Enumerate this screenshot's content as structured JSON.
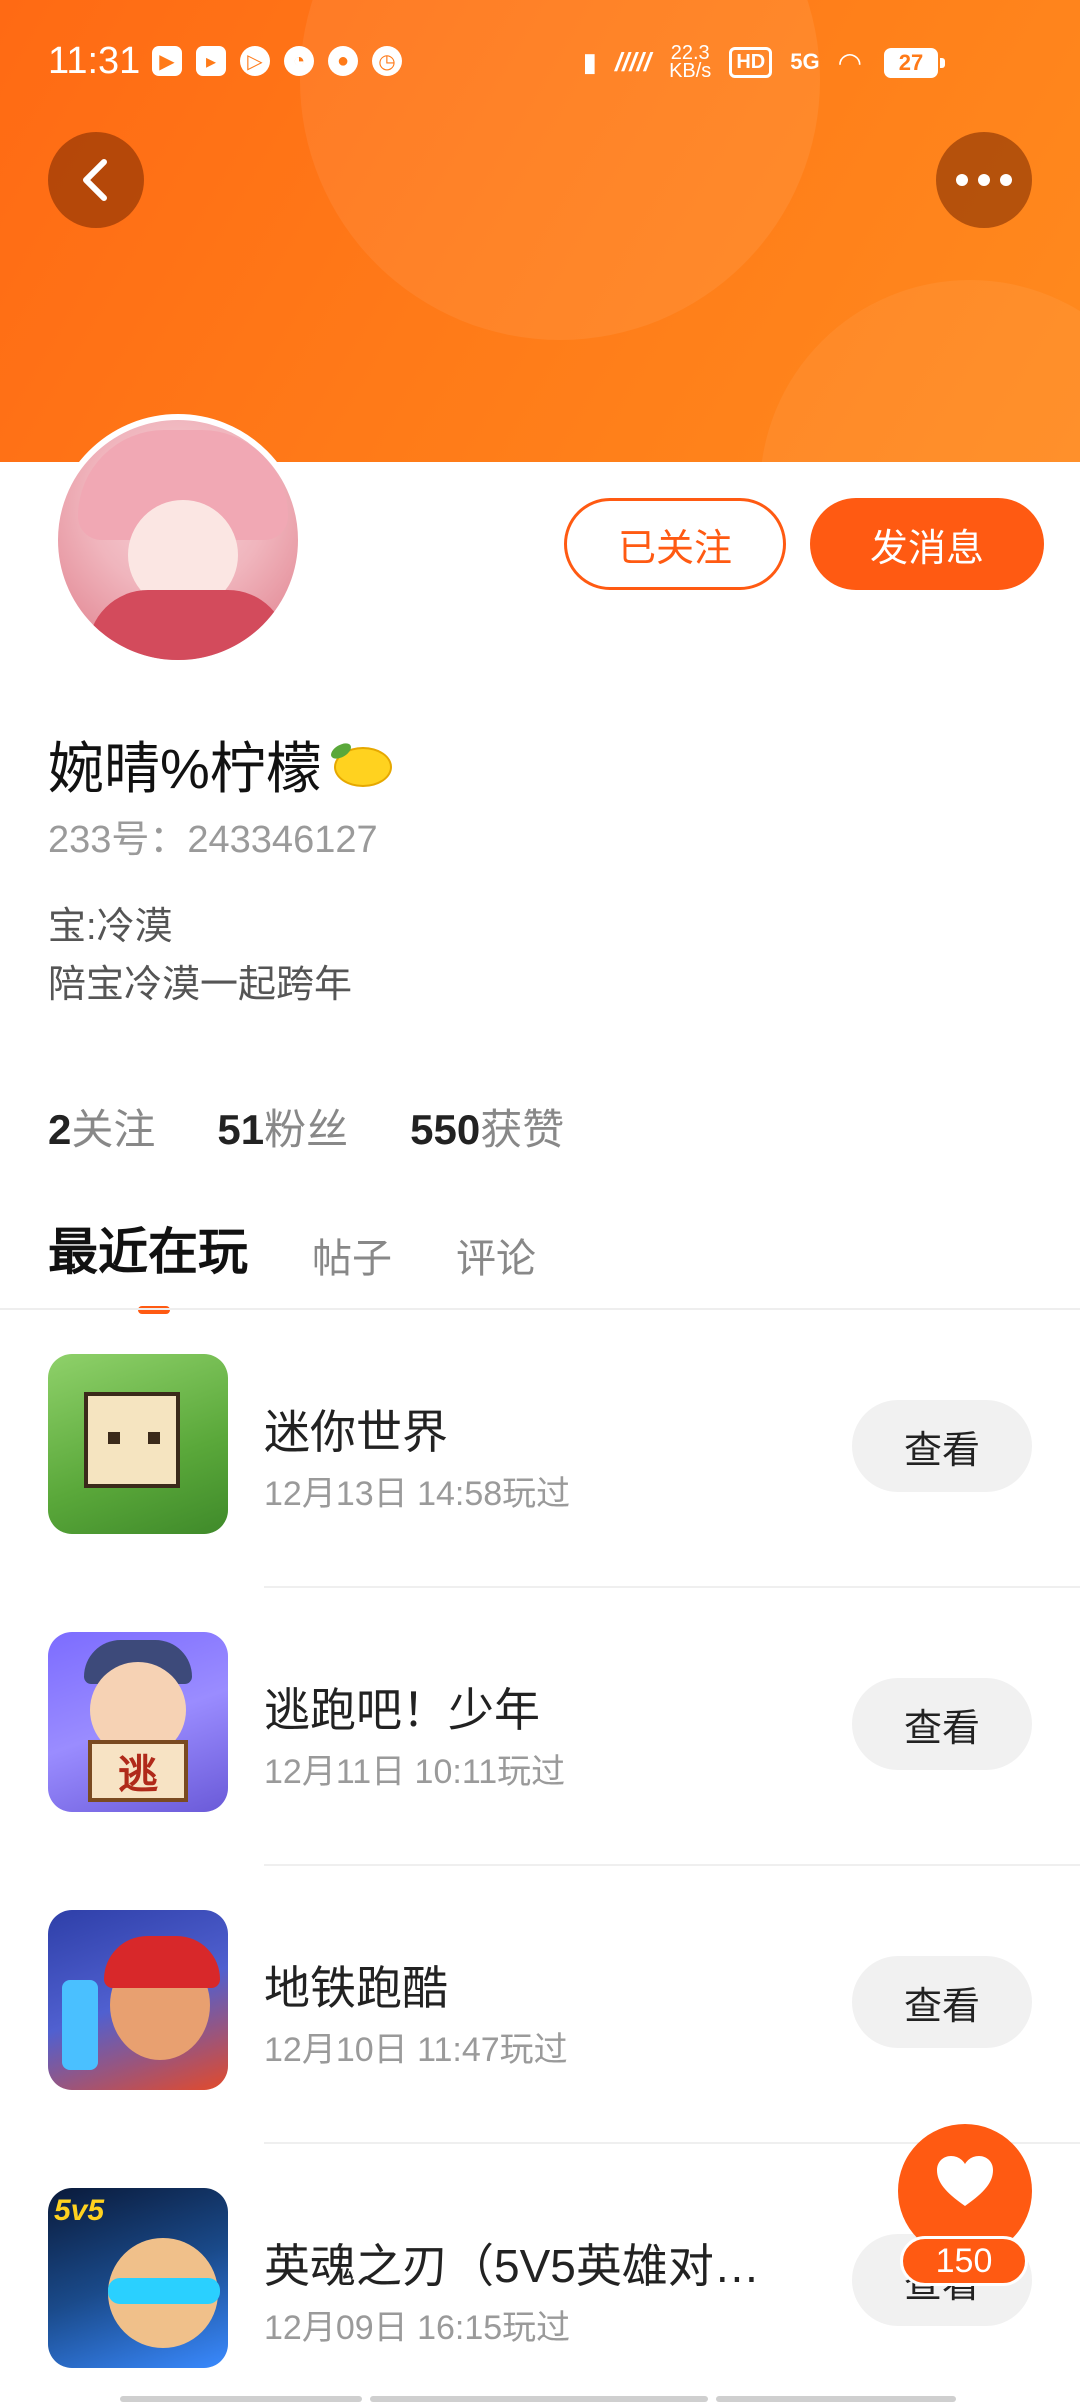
{
  "status_bar": {
    "time": "11:31",
    "net_speed": "22.3\nKB/s",
    "hd": "HD",
    "network": "5G",
    "battery": "27"
  },
  "profile": {
    "follow_button": "已关注",
    "message_button": "发消息",
    "username": "婉晴%柠檬",
    "id_line": "233号：243346127",
    "bio_line1": "宝:冷漠",
    "bio_line2": "陪宝冷漠一起跨年"
  },
  "stats": {
    "following": {
      "count": "2",
      "label": "关注"
    },
    "fans": {
      "count": "51",
      "label": "粉丝"
    },
    "likes": {
      "count": "550",
      "label": "获赞"
    }
  },
  "tabs": [
    "最近在玩",
    "帖子",
    "评论"
  ],
  "games": [
    {
      "title": "迷你世界",
      "time": "12月13日 14:58玩过",
      "button": "查看"
    },
    {
      "title": "逃跑吧！少年",
      "time": "12月11日 10:11玩过",
      "button": "查看"
    },
    {
      "title": "地铁跑酷",
      "time": "12月10日 11:47玩过",
      "button": "查看"
    },
    {
      "title": "英魂之刃（5V5英雄对…",
      "time": "12月09日 16:15玩过",
      "button": "查看"
    }
  ],
  "game_icon_text": {
    "escape_sign": "逃",
    "badge_5v5": "5v5"
  },
  "fab": {
    "count": "150"
  },
  "colors": {
    "accent": "#ff5a12",
    "header": "#ff7a18"
  }
}
